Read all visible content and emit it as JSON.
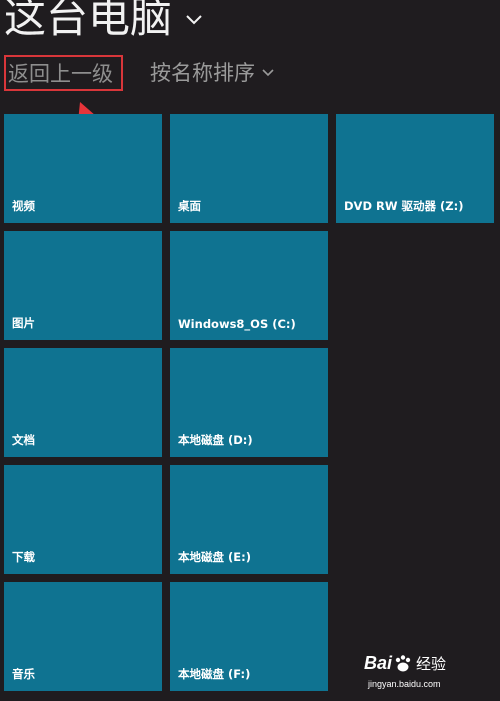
{
  "header": {
    "title": "这台电脑",
    "back_label": "返回上一级",
    "sort_label": "按名称排序"
  },
  "tiles": [
    {
      "label": "视频"
    },
    {
      "label": "桌面"
    },
    {
      "label": "DVD RW 驱动器 (Z:)"
    },
    {
      "label": "图片"
    },
    {
      "label": "Windows8_OS (C:)"
    },
    {
      "label": "文档"
    },
    {
      "label": "本地磁盘 (D:)"
    },
    {
      "label": "下载"
    },
    {
      "label": "本地磁盘 (E:)"
    },
    {
      "label": "音乐"
    },
    {
      "label": "本地磁盘 (F:)"
    }
  ],
  "watermark": {
    "logo_left": "Bai",
    "logo_right": "经验",
    "url": "jingyan.baidu.com"
  },
  "colors": {
    "background": "#1f1c1f",
    "tile": "#0f7391",
    "highlight_box": "#d9363a",
    "annotation_arrow": "#e8343a"
  }
}
